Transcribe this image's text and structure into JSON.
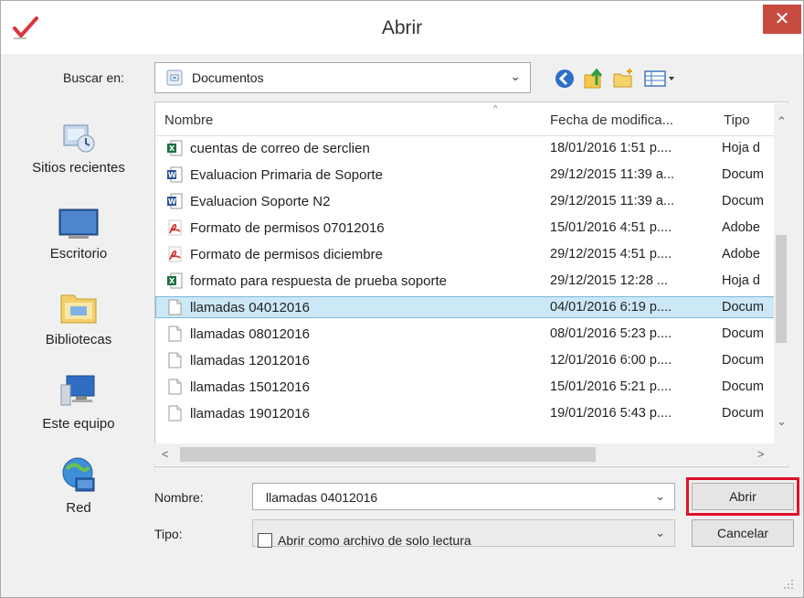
{
  "window": {
    "title": "Abrir",
    "close_glyph": "✕",
    "app_icon": "checkmark-logo-icon"
  },
  "lookin": {
    "label": "Buscar en:",
    "value": "Documentos",
    "dropdown_glyph": "⌄"
  },
  "toolbar": {
    "icons": [
      "back-icon",
      "up-folder-icon",
      "new-folder-icon",
      "view-menu-icon"
    ]
  },
  "places": [
    {
      "label": "Sitios recientes",
      "icon": "recent-places-icon"
    },
    {
      "label": "Escritorio",
      "icon": "desktop-icon"
    },
    {
      "label": "Bibliotecas",
      "icon": "libraries-icon"
    },
    {
      "label": "Este equipo",
      "icon": "computer-icon"
    },
    {
      "label": "Red",
      "icon": "network-icon"
    }
  ],
  "columns": {
    "name": "Nombre",
    "date": "Fecha de modifica...",
    "type": "Tipo"
  },
  "files": [
    {
      "name": "cuentas de correo de serclien",
      "date": "18/01/2016 1:51 p....",
      "type": "Hoja d",
      "icon": "excel-file-icon"
    },
    {
      "name": "Evaluacion Primaria de Soporte",
      "date": "29/12/2015 11:39 a...",
      "type": "Docum",
      "icon": "word-file-icon"
    },
    {
      "name": "Evaluacion Soporte N2",
      "date": "29/12/2015 11:39 a...",
      "type": "Docum",
      "icon": "word-file-icon"
    },
    {
      "name": "Formato de permisos 07012016",
      "date": "15/01/2016 4:51 p....",
      "type": "Adobe",
      "icon": "pdf-file-icon"
    },
    {
      "name": "Formato de permisos diciembre",
      "date": "29/12/2015 4:51 p....",
      "type": "Adobe",
      "icon": "pdf-file-icon"
    },
    {
      "name": "formato para respuesta de prueba soporte",
      "date": "29/12/2015 12:28 ...",
      "type": "Hoja d",
      "icon": "excel-file-icon"
    },
    {
      "name": "llamadas 04012016",
      "date": "04/01/2016 6:19 p....",
      "type": "Docum",
      "icon": "text-file-icon",
      "selected": true
    },
    {
      "name": "llamadas 08012016",
      "date": "08/01/2016 5:23 p....",
      "type": "Docum",
      "icon": "text-file-icon"
    },
    {
      "name": "llamadas 12012016",
      "date": "12/01/2016 6:00 p....",
      "type": "Docum",
      "icon": "text-file-icon"
    },
    {
      "name": "llamadas 15012016",
      "date": "15/01/2016 5:21 p....",
      "type": "Docum",
      "icon": "text-file-icon"
    },
    {
      "name": "llamadas 19012016",
      "date": "19/01/2016 5:43 p....",
      "type": "Docum",
      "icon": "text-file-icon"
    }
  ],
  "scroll": {
    "up": "⌃",
    "down": "⌄",
    "left": "<",
    "right": ">"
  },
  "form": {
    "name_label": "Nombre:",
    "name_value": "llamadas 04012016",
    "type_label": "Tipo:",
    "type_value": "",
    "dropdown_glyph": "⌄",
    "open_button": "Abrir",
    "cancel_button": "Cancelar",
    "readonly_label": "Abrir como archivo de solo lectura",
    "readonly_checked": false
  },
  "colors": {
    "selection": "#cce8f7",
    "close_button": "#c84b40",
    "highlight": "#e0102a"
  }
}
